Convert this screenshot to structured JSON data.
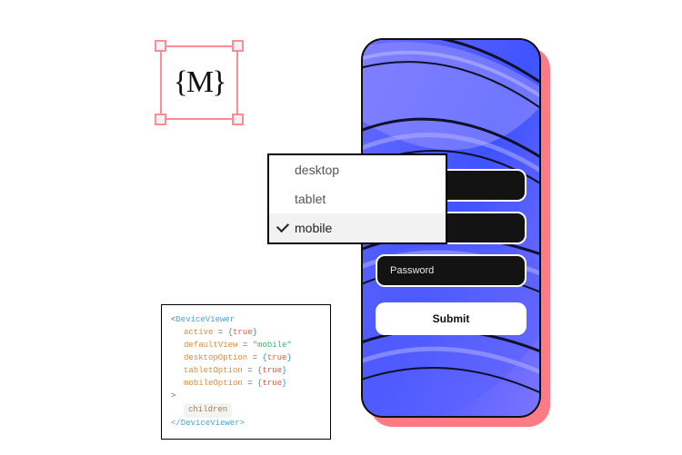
{
  "logo": {
    "text": "{M}"
  },
  "dropdown": {
    "items": [
      {
        "label": "desktop",
        "selected": false
      },
      {
        "label": "tablet",
        "selected": false
      },
      {
        "label": "mobile",
        "selected": true
      }
    ]
  },
  "phone_form": {
    "field1_placeholder": "",
    "field2_placeholder": "",
    "field3_placeholder": "Password",
    "submit_label": "Submit"
  },
  "code": {
    "open_lt": "<",
    "component": "DeviceViewer",
    "lines": [
      {
        "attr": "active",
        "eq": " = ",
        "lb": "{",
        "val": "true",
        "rb": "}",
        "is_string": false
      },
      {
        "attr": "defaultView",
        "eq": " = ",
        "lb": "",
        "val": "\"mobile\"",
        "rb": "",
        "is_string": true
      },
      {
        "attr": "desktopOption",
        "eq": " = ",
        "lb": "{",
        "val": "true",
        "rb": "}",
        "is_string": false
      },
      {
        "attr": "tabletOption",
        "eq": " = ",
        "lb": "{",
        "val": "true",
        "rb": "}",
        "is_string": false
      },
      {
        "attr": "mobileOption",
        "eq": " = ",
        "lb": "{",
        "val": "true",
        "rb": "}",
        "is_string": false
      }
    ],
    "open_gt": ">",
    "children_label": "children",
    "close": "</DeviceViewer>"
  }
}
